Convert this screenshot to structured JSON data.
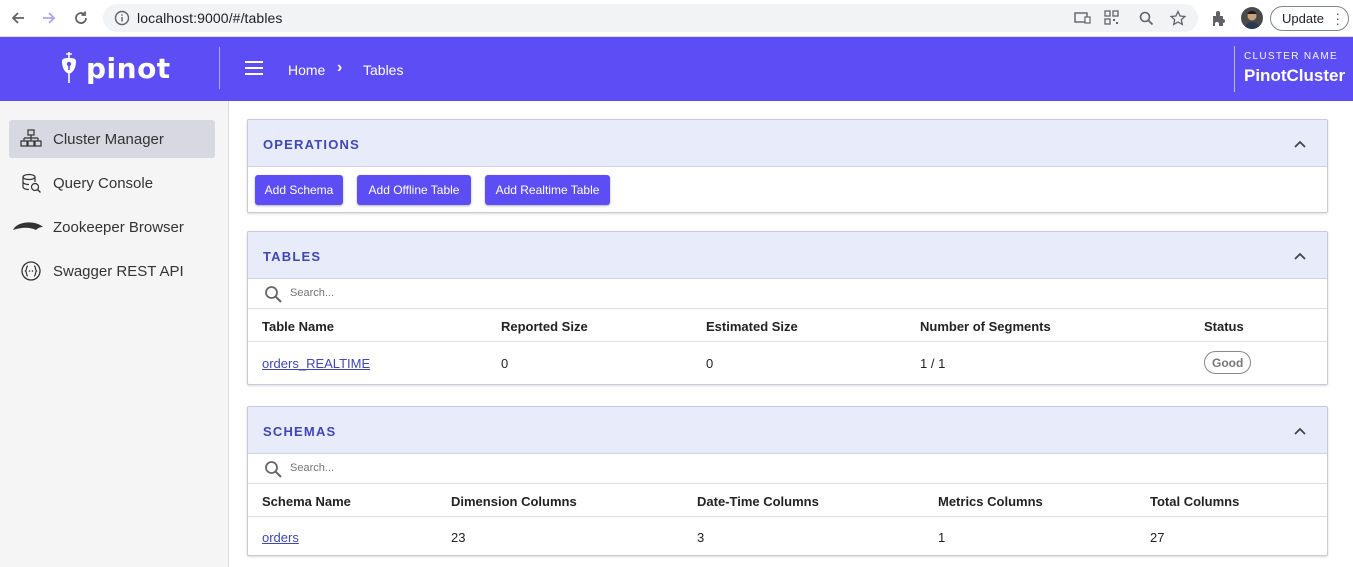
{
  "browser": {
    "url": "localhost:9000/#/tables",
    "update_label": "Update"
  },
  "appbar": {
    "logo_text": "pinot",
    "breadcrumb": [
      "Home",
      "Tables"
    ],
    "cluster_label": "CLUSTER NAME",
    "cluster_name": "PinotCluster",
    "bg_color": "#5c4ef4"
  },
  "sidebar": {
    "items": [
      {
        "label": "Cluster Manager",
        "icon": "cluster-icon",
        "active": true
      },
      {
        "label": "Query Console",
        "icon": "database-icon",
        "active": false
      },
      {
        "label": "Zookeeper Browser",
        "icon": "zookeeper-icon",
        "active": false
      },
      {
        "label": "Swagger REST API",
        "icon": "swagger-icon",
        "active": false
      }
    ]
  },
  "operations": {
    "title": "OPERATIONS",
    "buttons": [
      "Add Schema",
      "Add Offline Table",
      "Add Realtime Table"
    ]
  },
  "tables": {
    "title": "TABLES",
    "search_placeholder": "Search...",
    "columns": [
      "Table Name",
      "Reported Size",
      "Estimated Size",
      "Number of Segments",
      "Status"
    ],
    "rows": [
      [
        "orders_REALTIME",
        "0",
        "0",
        "1 / 1",
        "Good"
      ]
    ]
  },
  "schemas": {
    "title": "SCHEMAS",
    "search_placeholder": "Search...",
    "columns": [
      "Schema Name",
      "Dimension Columns",
      "Date-Time Columns",
      "Metrics Columns",
      "Total Columns"
    ],
    "rows": [
      [
        "orders",
        "23",
        "3",
        "1",
        "27"
      ]
    ]
  }
}
